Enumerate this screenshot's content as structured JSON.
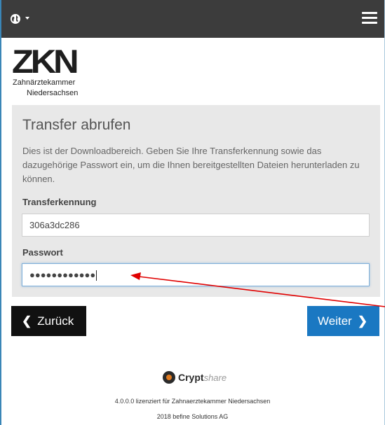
{
  "header": {
    "language_icon": "globe-icon",
    "menu_icon": "hamburger-icon"
  },
  "logo": {
    "word": "ZKN",
    "line1": "Zahnärztekammer",
    "line2": "Niedersachsen"
  },
  "panel": {
    "title": "Transfer abrufen",
    "description": "Dies ist der Downloadbereich. Geben Sie Ihre Transferkennung sowie das dazugehörige Passwort ein, um die Ihnen bereitgestellten Dateien herunterladen zu können.",
    "transfer_label": "Transferkennung",
    "transfer_value": "306a3dc286",
    "password_label": "Passwort",
    "password_value": "●●●●●●●●●●●●"
  },
  "buttons": {
    "back_label": "Zurück",
    "next_label": "Weiter"
  },
  "footer": {
    "brand_crypt": "Crypt",
    "brand_share": "share",
    "license": "4.0.0.0 lizenziert für Zahnaerztekammer Niedersachsen",
    "copyright": "2018 befine Solutions AG"
  },
  "colors": {
    "topbar": "#3c3c3c",
    "next_button": "#1a78c2",
    "back_button": "#111111",
    "annotation_arrow": "#e00000"
  }
}
